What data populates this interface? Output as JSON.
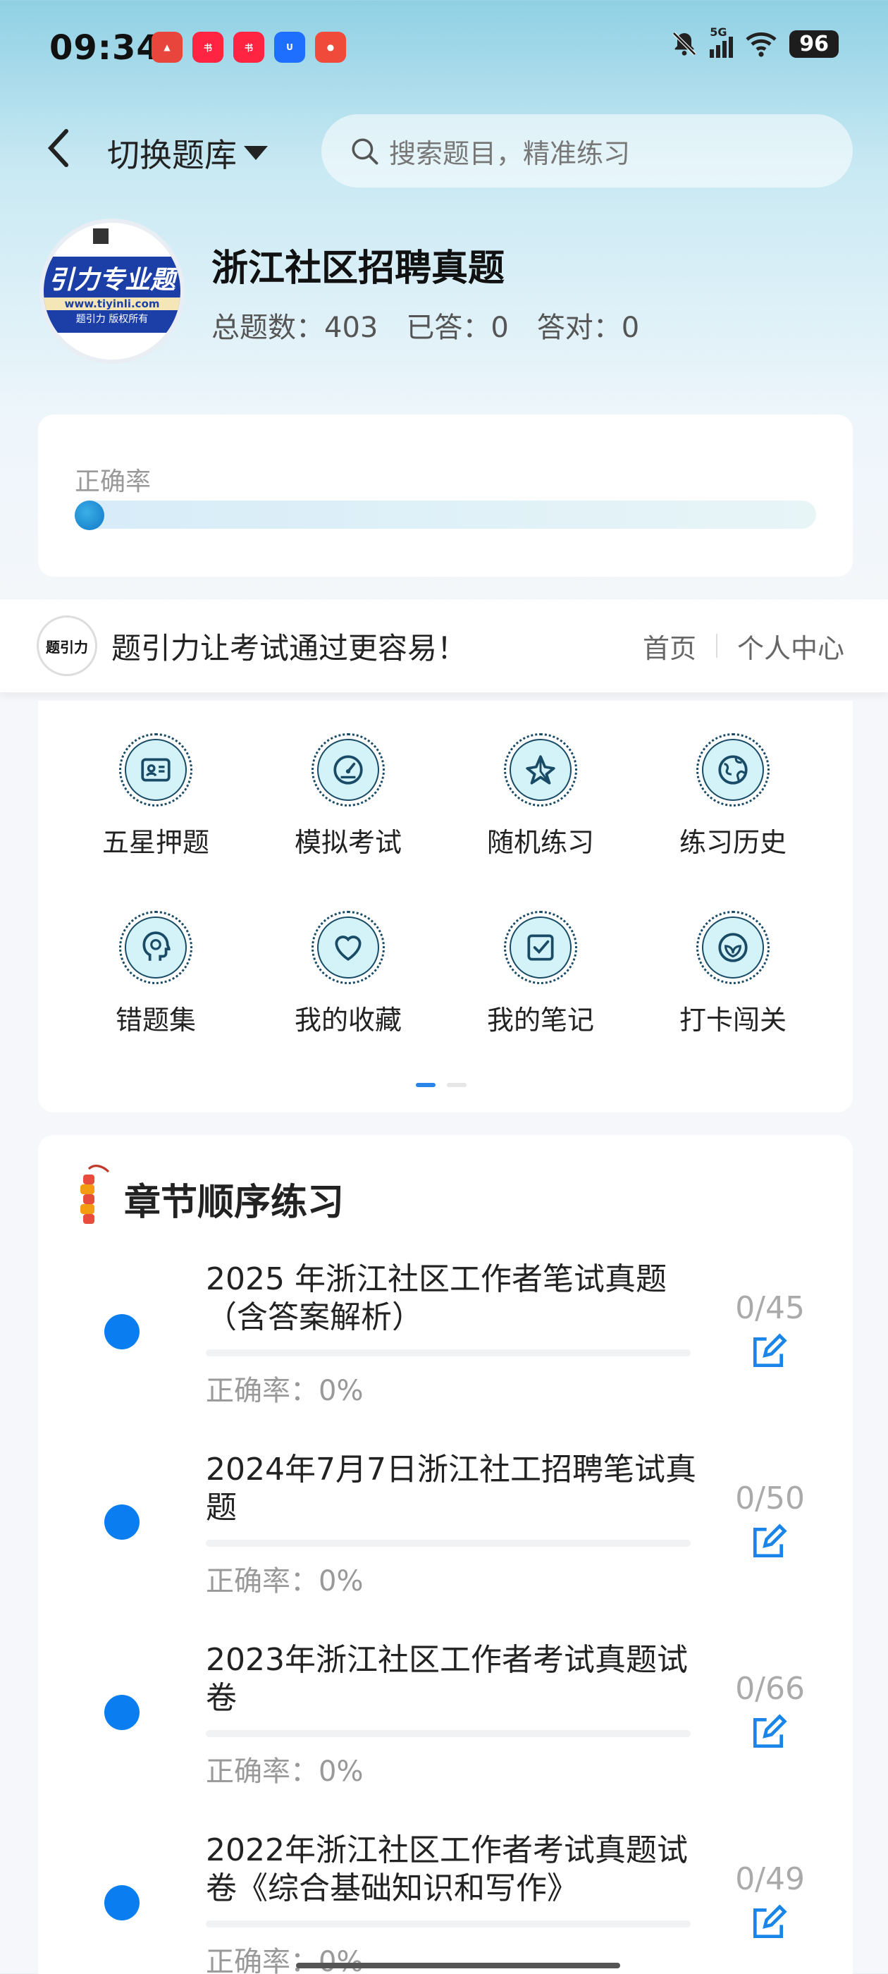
{
  "status_bar": {
    "time": "09:34",
    "network": "5G",
    "battery": "96"
  },
  "header": {
    "switch_label": "切换题库",
    "search_placeholder": "搜索题目，精准练习"
  },
  "bank": {
    "logo_big": "引力专业题",
    "logo_url": "www.tiyinli.com",
    "logo_small": "题引力 版权所有",
    "title": "浙江社区招聘真题",
    "total": "总题数：403",
    "answered": "已答：0",
    "correct": "答对：0"
  },
  "accuracy": {
    "label": "正确率",
    "progress": 0
  },
  "promo": {
    "logo_text": "题引力",
    "text": "题引力让考试通过更容易！",
    "home_link": "首页",
    "profile_link": "个人中心"
  },
  "menu": [
    {
      "label": "五星押题",
      "icon": "id-card-icon"
    },
    {
      "label": "模拟考试",
      "icon": "speedometer-icon"
    },
    {
      "label": "随机练习",
      "icon": "random-icon"
    },
    {
      "label": "练习历史",
      "icon": "globe-icon"
    },
    {
      "label": "错题集",
      "icon": "head-icon"
    },
    {
      "label": "我的收藏",
      "icon": "heart-icon"
    },
    {
      "label": "我的笔记",
      "icon": "note-check-icon"
    },
    {
      "label": "打卡闯关",
      "icon": "badge-icon"
    }
  ],
  "chapter": {
    "title": "章节顺序练习",
    "items": [
      {
        "name": "2025 年浙江社区工作者笔试真题（含答案解析）",
        "accuracy": "正确率：0%",
        "count": "0/45"
      },
      {
        "name": "2024年7月7日浙江社工招聘笔试真题",
        "accuracy": "正确率：0%",
        "count": "0/50"
      },
      {
        "name": "2023年浙江社区工作者考试真题试卷",
        "accuracy": "正确率：0%",
        "count": "0/66"
      },
      {
        "name": "2022年浙江社区工作者考试真题试卷《综合基础知识和写作》",
        "accuracy": "正确率：0%",
        "count": "0/49"
      }
    ]
  },
  "colors": {
    "accent": "#0a7ef0",
    "icon_bg": "#d4f3f8",
    "icon_stroke": "#1a4b66"
  }
}
